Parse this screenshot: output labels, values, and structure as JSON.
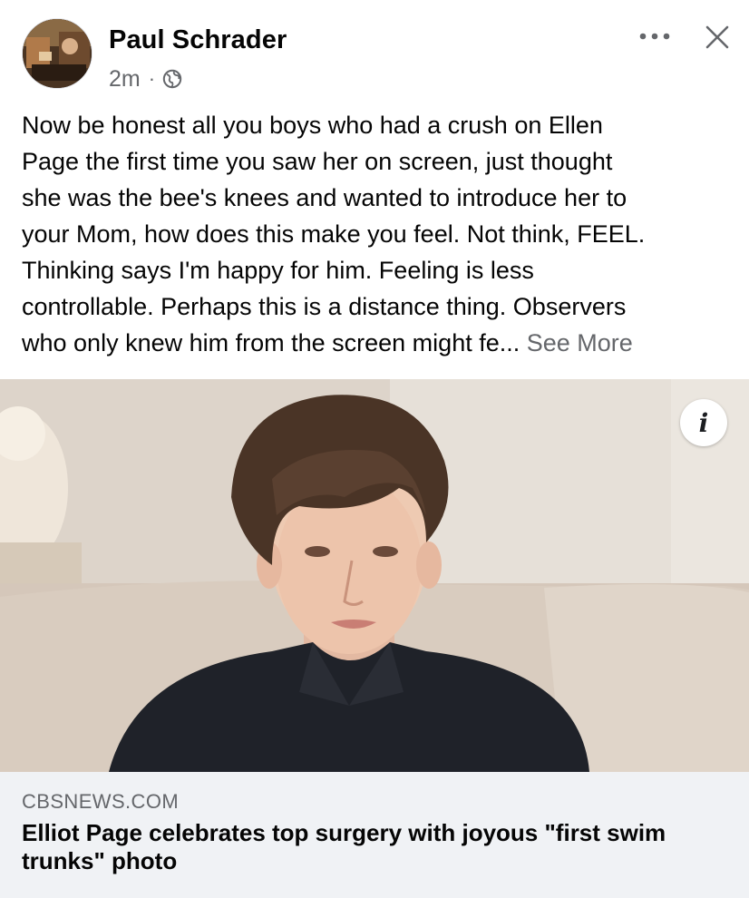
{
  "post": {
    "author": "Paul Schrader",
    "timestamp": "2m",
    "separator": "·",
    "audience_icon": "globe-icon",
    "text": "Now be honest all you boys who had a crush on Ellen\nPage the first time you saw her on screen, just thought\nshe was the bee's knees and wanted to introduce her to\nyour Mom, how does this make you feel. Not think, FEEL.\nThinking says I'm happy for him. Feeling is less\ncontrollable. Perhaps this is a distance thing. Observers\nwho only knew him from the screen might fe... ",
    "see_more_label": "See More",
    "more_icon": "more-options-icon",
    "close_icon": "close-icon"
  },
  "link": {
    "domain": "CBSNEWS.COM",
    "title": "Elliot Page celebrates top surgery with joyous \"first swim trunks\" photo",
    "info_icon_label": "i"
  },
  "colors": {
    "text_primary": "#050505",
    "text_secondary": "#65676b",
    "card_background": "#f0f2f5"
  }
}
